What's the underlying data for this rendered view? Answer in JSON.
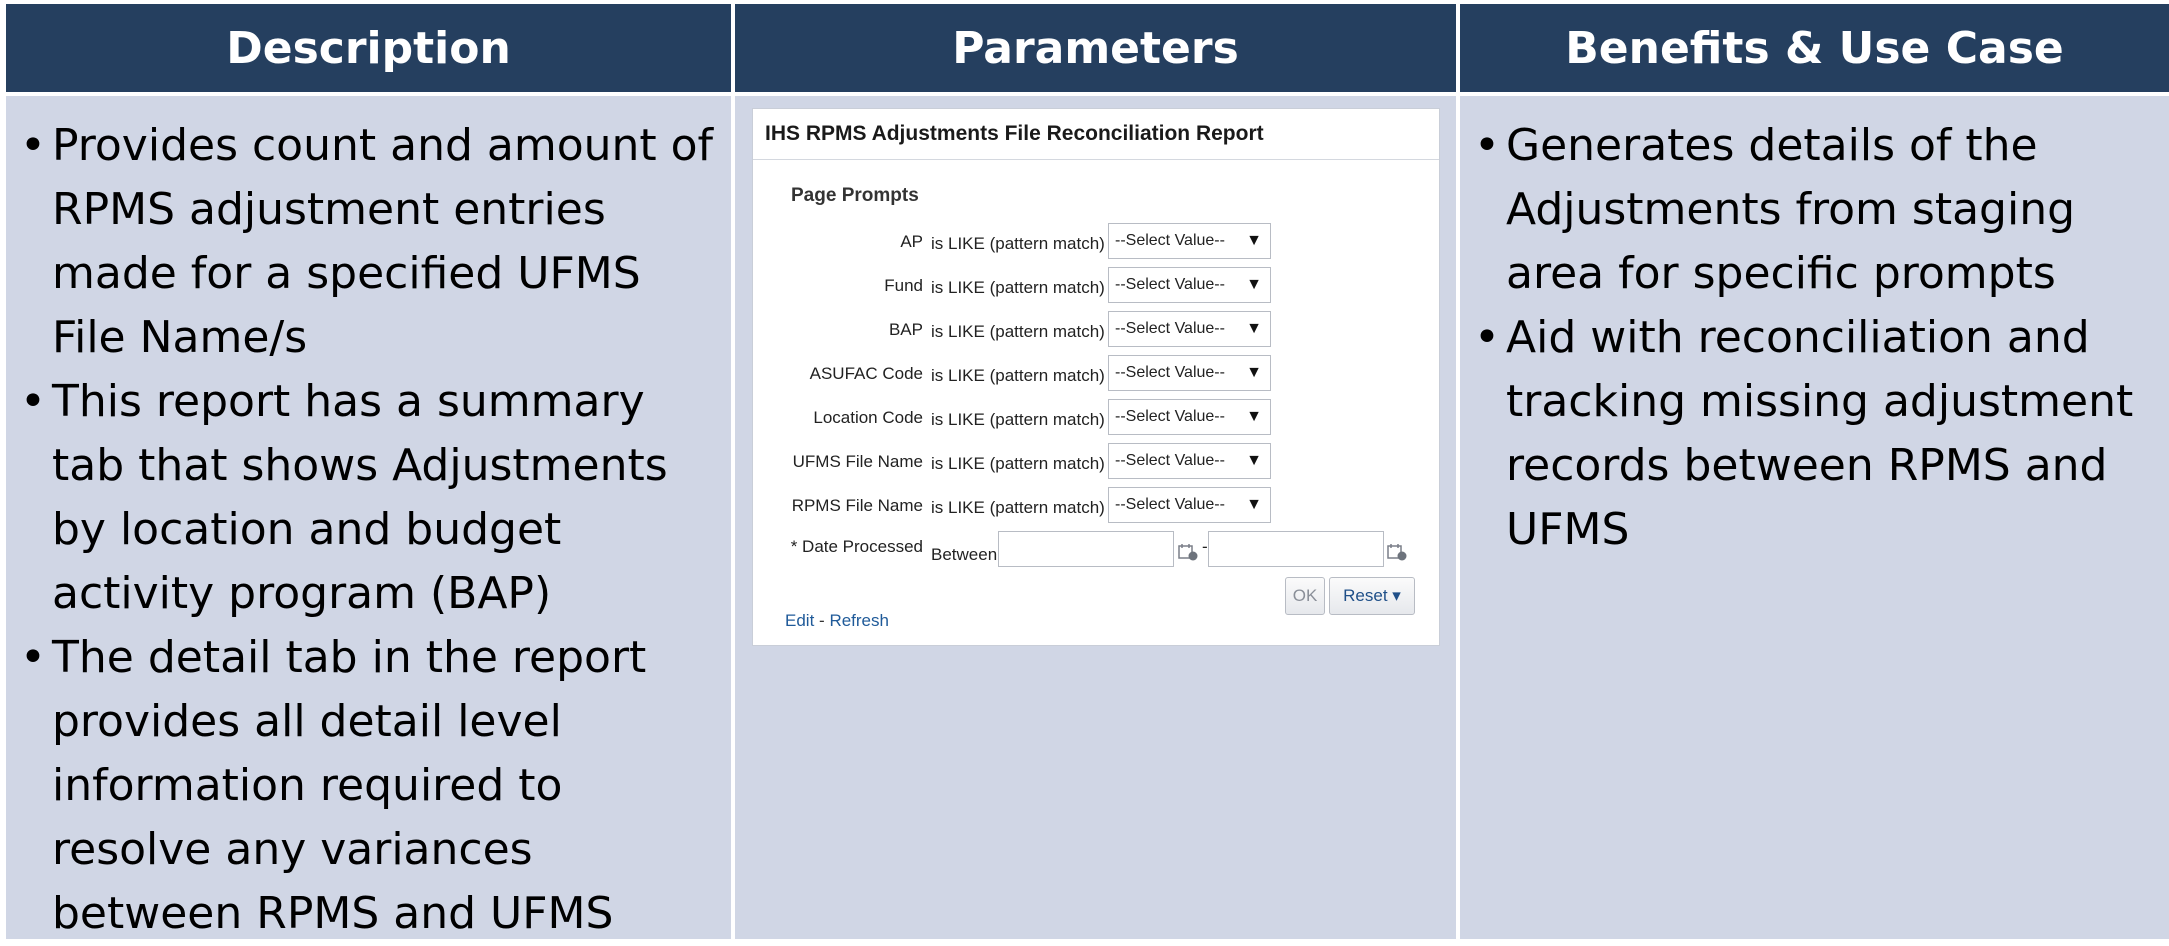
{
  "headers": {
    "description": "Description",
    "parameters": "Parameters",
    "benefits": "Benefits & Use Case"
  },
  "description_bullets": [
    "Provides count and amount of RPMS adjustment entries made for a specified UFMS File Name/s",
    "This report has a summary tab that shows Adjustments by location and budget activity program (BAP)",
    "The detail tab in the report provides all detail level information required to resolve any variances between RPMS and UFMS"
  ],
  "benefits_bullets": [
    "Generates details of the Adjustments from staging area for specific prompts",
    "Aid with reconciliation and tracking missing adjustment records between RPMS and UFMS"
  ],
  "report": {
    "title": "IHS RPMS Adjustments File Reconciliation Report",
    "section_title": "Page Prompts",
    "prompts": [
      {
        "label": "AP",
        "operator": "is LIKE (pattern match)",
        "value": "--Select Value--"
      },
      {
        "label": "Fund",
        "operator": "is LIKE (pattern match)",
        "value": "--Select Value--"
      },
      {
        "label": "BAP",
        "operator": "is LIKE (pattern match)",
        "value": "--Select Value--"
      },
      {
        "label": "ASUFAC Code",
        "operator": "is LIKE (pattern match)",
        "value": "--Select Value--"
      },
      {
        "label": "Location Code",
        "operator": "is LIKE (pattern match)",
        "value": "--Select Value--"
      },
      {
        "label": "UFMS File Name",
        "operator": "is LIKE (pattern match)",
        "value": "--Select Value--"
      },
      {
        "label": "RPMS File Name",
        "operator": "is LIKE (pattern match)",
        "value": "--Select Value--"
      }
    ],
    "date_prompt": {
      "label": "* Date Processed",
      "operator": "Between",
      "separator": "-"
    },
    "ok_label": "OK",
    "reset_label": "Reset ▾",
    "edit_link": "Edit",
    "link_separator": "-",
    "refresh_link": "Refresh"
  },
  "colors": {
    "header_bg": "#253f5f",
    "body_bg": "#d0d6e5",
    "link": "#1f5a99"
  }
}
